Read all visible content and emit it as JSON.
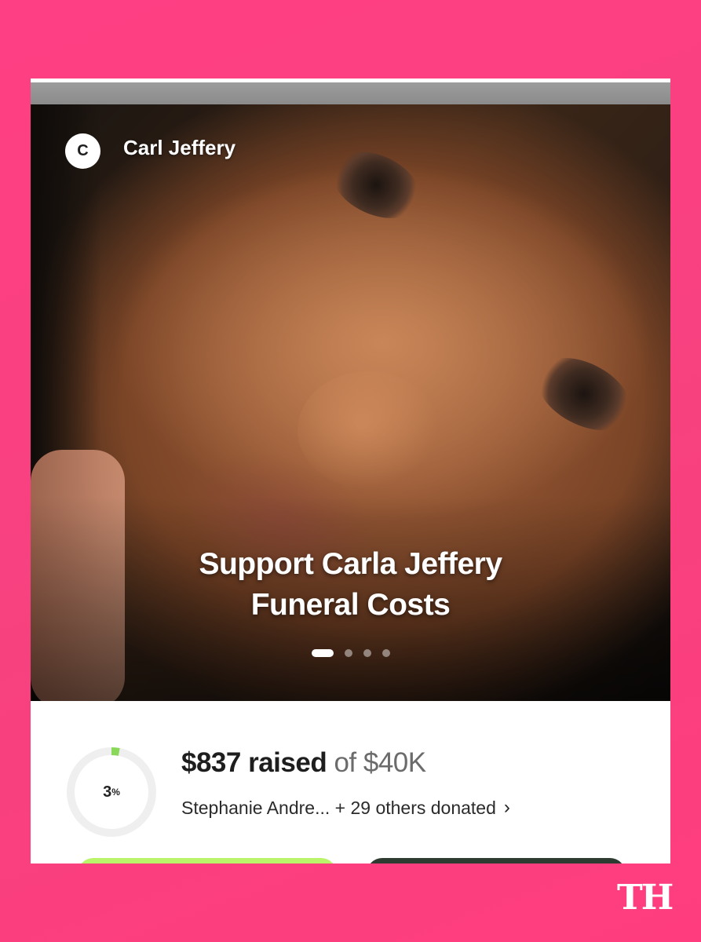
{
  "campaign": {
    "organizer_initial": "C",
    "organizer_name": "Carl Jeffery",
    "title_line1": "Support Carla Jeffery",
    "title_line2": "Funeral Costs",
    "carousel_total": 4,
    "carousel_active": 1
  },
  "progress": {
    "percent_value": 3,
    "percent_label": "3",
    "percent_sign": "%",
    "raised_amount": "$837 raised",
    "goal_text": "of $40K",
    "donors_text": "Stephanie Andre... + 29 others donated",
    "chevron": "›"
  },
  "colors": {
    "background_pink": "#ff3f83",
    "progress_green": "#8ad85a",
    "donate_button": "#b9f46a",
    "share_button": "#2e3b31"
  },
  "watermark": {
    "text": "TH"
  }
}
